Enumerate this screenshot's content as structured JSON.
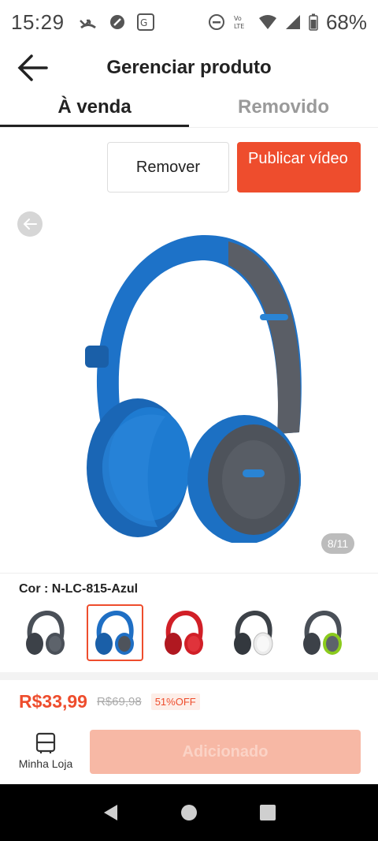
{
  "status_bar": {
    "time": "15:29",
    "battery": "68%"
  },
  "header": {
    "title": "Gerenciar produto"
  },
  "tabs": [
    {
      "label": "À venda",
      "active": true
    },
    {
      "label": "Removido",
      "active": false
    }
  ],
  "actions": {
    "remove_label": "Remover",
    "publish_label": "Publicar vídeo"
  },
  "gallery": {
    "counter": "8/11"
  },
  "variation": {
    "label": "Cor : N-LC-815-Azul",
    "options": [
      {
        "color": "#4a5058",
        "selected": false
      },
      {
        "color": "#1f6fc4",
        "selected": true
      },
      {
        "color": "#d11f27",
        "selected": false
      },
      {
        "color": "#ececec",
        "selected": false
      },
      {
        "color": "#8bcb1d",
        "selected": false
      }
    ]
  },
  "price": {
    "current": "R$33,99",
    "original": "R$69,98",
    "discount": "51%OFF"
  },
  "bottom": {
    "shop_label": "Minha Loja",
    "add_label": "Adicionado"
  },
  "colors": {
    "accent": "#ee4d2d",
    "disabled_button": "#f7b8a5"
  }
}
